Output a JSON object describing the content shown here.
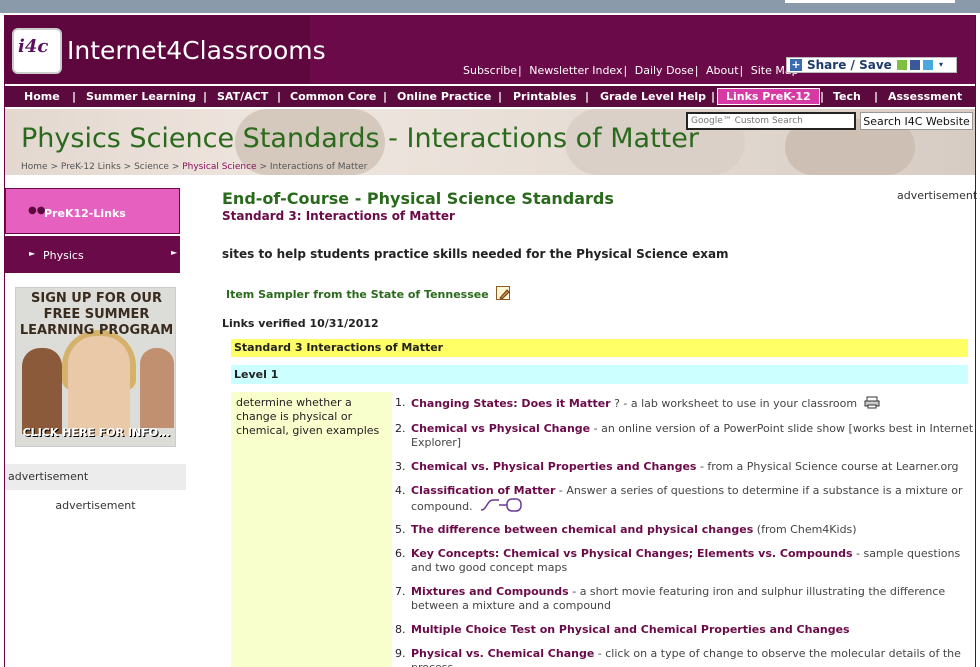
{
  "header": {
    "logo_badge": "i4c",
    "logo_text": "Internet4Classrooms",
    "top_links": [
      "Subscribe",
      "Newsletter Index",
      "Daily Dose",
      "About",
      "Site Map"
    ],
    "share_label": "Share / Save"
  },
  "nav": {
    "items": [
      "Home",
      "Summer Learning",
      "SAT/ACT",
      "Common Core",
      "Online Practice",
      "Printables",
      "Grade Level Help",
      "Links PreK-12",
      "Tech",
      "Assessment"
    ],
    "active_index": 7,
    "colors": {
      "bar": "#5a0a3c",
      "active": "#d63aa4"
    }
  },
  "banner": {
    "title": "Physics Science Standards - Interactions of Matter",
    "breadcrumb": [
      "Home",
      "PreK-12 Links",
      "Science",
      "Physical Science",
      "Interactions of Matter"
    ],
    "search_placeholder": "Google™ Custom Search",
    "search_button": "Search I4C Website"
  },
  "sidebar": {
    "header": "PreK12-Links",
    "sub_item": "Physics",
    "promo_text": "SIGN UP FOR OUR FREE SUMMER LEARNING PROGRAM",
    "promo_click": "CLICK HERE FOR INFO...",
    "ad_label_1": "advertisement",
    "ad_label_2": "advertisement"
  },
  "main": {
    "title": "End-of-Course - Physical Science Standards",
    "subtitle": "Standard 3: Interactions of Matter",
    "ad_label": "advertisement",
    "intro": "sites to help students practice skills needed for the Physical Science exam",
    "sampler_link": "Item Sampler from the State of Tennessee",
    "verified": "Links verified 10/31/2012",
    "standard_row": "Standard 3 Interactions of Matter",
    "level_row": "Level 1",
    "objective": "determine whether a change is physical or chemical, given examples",
    "links": [
      {
        "num": "1.",
        "title": "Changing States: Does it Matter",
        "desc": " ? - a lab worksheet to use in your classroom",
        "icon": "printer-icon"
      },
      {
        "num": "2.",
        "title": "Chemical vs Physical Change",
        "desc": "  - an online version of a PowerPoint slide show [works best in Internet Explorer]",
        "icon": ""
      },
      {
        "num": "3.",
        "title": "Chemical vs. Physical Properties and Changes",
        "desc": "  - from a Physical Science course at Learner.org",
        "icon": ""
      },
      {
        "num": "4.",
        "title": "Classification of Matter",
        "desc": " - Answer a series of questions to determine if a substance is a mixture or compound.",
        "icon": "interactive-icon"
      },
      {
        "num": "5.",
        "title": "The difference between chemical and physical changes",
        "desc": "  (from Chem4Kids)",
        "icon": ""
      },
      {
        "num": "6.",
        "title": "Key Concepts: Chemical vs Physical Changes; Elements vs. Compounds",
        "desc": "  - sample questions and two good concept maps",
        "icon": ""
      },
      {
        "num": "7.",
        "title": "Mixtures and Compounds",
        "desc": "  - a short movie featuring iron and sulphur illustrating the difference between a mixture and a compound",
        "icon": ""
      },
      {
        "num": "8.",
        "title": "Multiple Choice Test on Physical and Chemical Properties and Changes",
        "desc": "",
        "icon": ""
      },
      {
        "num": "9.",
        "title": "Physical vs. Chemical Change",
        "desc": " - click on a type of change to observe the molecular details of the process",
        "icon": ""
      }
    ]
  }
}
